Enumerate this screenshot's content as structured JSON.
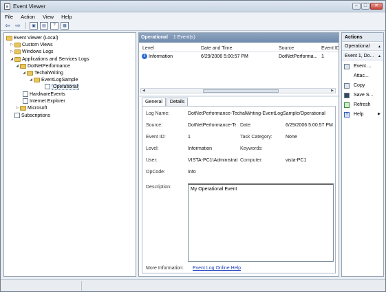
{
  "window": {
    "title": "Event Viewer",
    "min": "–",
    "max": "□",
    "close": "✕"
  },
  "menu": [
    "File",
    "Action",
    "View",
    "Help"
  ],
  "toolbar": {
    "back": "⇦",
    "forward": "⇨",
    "btn1": "▣",
    "btn2": "▤",
    "btn3": "?",
    "btn4": "▦"
  },
  "tree": {
    "root": "Event Viewer (Local)",
    "custom_views": "Custom Views",
    "windows_logs": "Windows Logs",
    "app_services": "Applications and Services Logs",
    "dotnet": "DotNetPerformance",
    "techal": "TechalWriting",
    "eventlogsample": "EventLogSample",
    "operational": "Operational",
    "hardware": "HardwareEvents",
    "ie": "Internet Explorer",
    "microsoft": "Microsoft",
    "subscriptions": "Subscriptions"
  },
  "list": {
    "title": "Operational",
    "count": "1 Event(s)",
    "columns": [
      "Level",
      "Date and Time",
      "Source",
      "Event ID"
    ],
    "rows": [
      {
        "level": "Information",
        "datetime": "6/29/2006 5:00:57 PM",
        "source": "DotNetPerforma...",
        "event_id": "1"
      }
    ]
  },
  "detail": {
    "tabs": [
      "General",
      "Details"
    ],
    "labels": {
      "log_name": "Log Name:",
      "source": "Source:",
      "event_id": "Event ID:",
      "level": "Level:",
      "user": "User:",
      "opcode": "OpCode:",
      "description": "Description:",
      "date": "Date:",
      "task_category": "Task Category:",
      "keywords": "Keywords:",
      "computer": "Computer:",
      "more_info": "More Information:"
    },
    "values": {
      "log_name": "DotNetPerformance-TechalWriting-EventLogSample/Operational",
      "source": "DotNetPerformance-Te",
      "event_id": "1",
      "level": "Information",
      "user": "VISTA-PC1\\Administrat",
      "opcode": "Info",
      "date": "6/29/2006 5:00:57 PM",
      "task_category": "None",
      "keywords": "",
      "computer": "vista-PC1",
      "description": "My Operational Event",
      "more_info_link": "Event Log Online Help"
    }
  },
  "actions": {
    "title": "Actions",
    "section1": "Operational",
    "section2": "Event 1, Do...",
    "items": [
      "Event ...",
      "Attac...",
      "Copy",
      "Save S...",
      "Refresh",
      "Help"
    ]
  }
}
